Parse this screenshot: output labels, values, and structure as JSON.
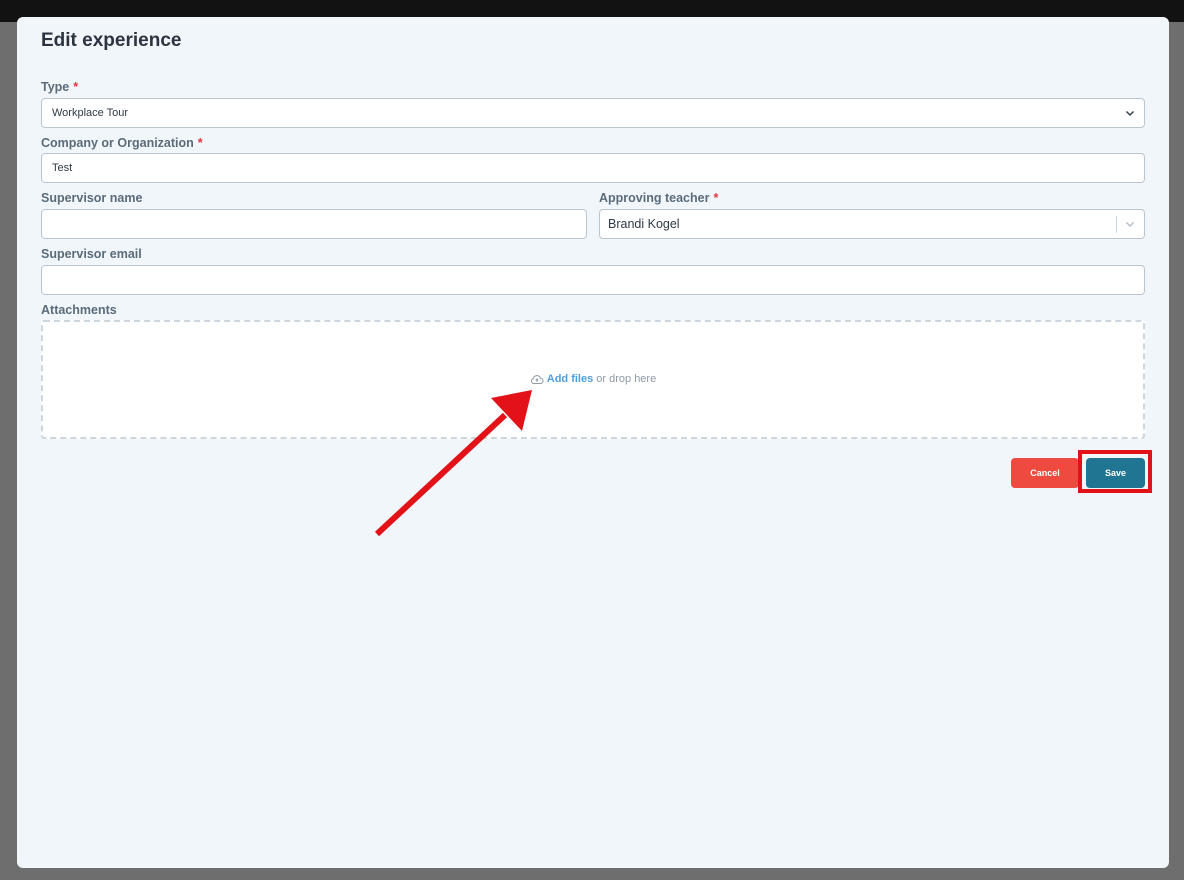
{
  "modal": {
    "title": "Edit experience"
  },
  "form": {
    "type": {
      "label": "Type",
      "required_mark": "*",
      "value": "Workplace Tour"
    },
    "company": {
      "label": "Company or Organization",
      "required_mark": "*",
      "value": "Test"
    },
    "supervisor_name": {
      "label": "Supervisor name",
      "value": ""
    },
    "approving_teacher": {
      "label": "Approving teacher",
      "required_mark": "*",
      "value": "Brandi Kogel"
    },
    "supervisor_email": {
      "label": "Supervisor email",
      "value": ""
    },
    "attachments": {
      "label": "Attachments",
      "add_files": "Add files",
      "drop_text": "or drop here"
    }
  },
  "actions": {
    "cancel_label": "Cancel",
    "save_label": "Save"
  },
  "colors": {
    "modal_background": "#f1f6fa",
    "required": "#e0363b",
    "link": "#4e9fdb",
    "cancel": "#ee4a3f",
    "save": "#1f7592",
    "annotation": "#e31218"
  },
  "icons": {
    "select_chevron": "chevron-down-icon",
    "upload": "cloud-upload-icon",
    "annotation_arrow": "arrow-annotation"
  }
}
